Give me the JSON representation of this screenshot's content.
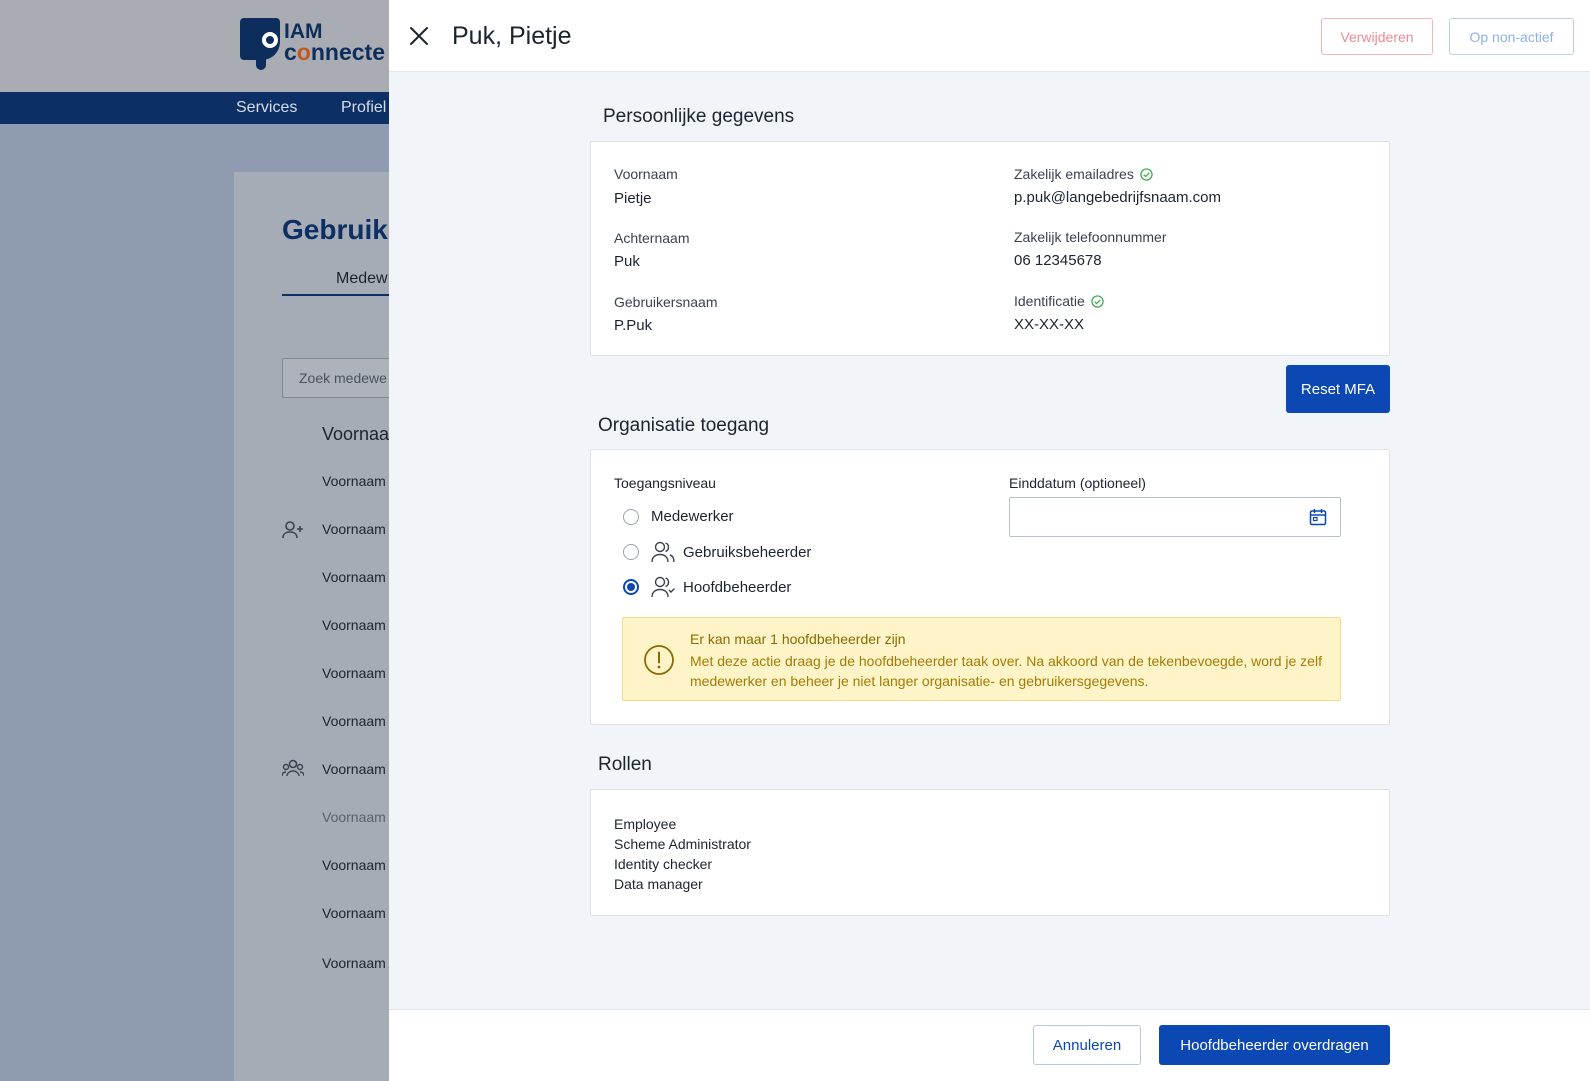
{
  "background": {
    "logo": {
      "line1": "IAM",
      "line2_a": "c",
      "line2_o": "o",
      "line2_b": "nnecte"
    },
    "nav": [
      "Services",
      "Profiel"
    ],
    "page_title": "Gebruik",
    "tab": "Medew",
    "search_placeholder": "Zoek medewe",
    "column_header": "Voornaa",
    "rows": [
      "Voornaam",
      "Voornaam",
      "Voornaam",
      "Voornaam",
      "Voornaam",
      "Voornaam",
      "Voornaam",
      "Voornaam",
      "Voornaam",
      "Voornaam",
      "Voornaam"
    ]
  },
  "panel": {
    "title": "Puk, Pietje",
    "delete_label": "Verwijderen",
    "inactive_label": "Op non-actief"
  },
  "personal": {
    "section_title": "Persoonlijke gegevens",
    "first_name_label": "Voornaam",
    "first_name": "Pietje",
    "last_name_label": "Achternaam",
    "last_name": "Puk",
    "username_label": "Gebruikersnaam",
    "username": "P.Puk",
    "email_label": "Zakelijk emailadres",
    "email": "p.puk@langebedrijfsnaam.com",
    "phone_label": "Zakelijk telefoonnummer",
    "phone": "06 12345678",
    "identification_label": "Identificatie",
    "identification": "XX-XX-XX",
    "reset_mfa_label": "Reset MFA"
  },
  "organisation": {
    "section_title": "Organisatie toegang",
    "access_level_label": "Toegangsniveau",
    "options": [
      "Medewerker",
      "Gebruiksbeheerder",
      "Hoofdbeheerder"
    ],
    "selected": "Hoofdbeheerder",
    "end_date_label": "Einddatum (optioneel)",
    "end_date_value": "",
    "warning_title": "Er kan maar 1 hoofdbeheerder zijn",
    "warning_body": "Met deze actie draag je de hoofdbeheerder taak over. Na akkoord van de tekenbevoegde, word je zelf medewerker en beheer je niet langer organisatie- en gebruikersgegevens."
  },
  "roles": {
    "section_title": "Rollen",
    "items": [
      "Employee",
      "Scheme Administrator",
      "Identity checker",
      "Data manager"
    ]
  },
  "footer": {
    "cancel_label": "Annuleren",
    "confirm_label": "Hoofdbeheerder overdragen"
  },
  "colors": {
    "primary": "#0c48b4",
    "nav": "#0c2f66",
    "warning_bg": "#fff4c8",
    "warning_text": "#a27c05",
    "verified": "#36a84a",
    "danger": "#ee8a90"
  },
  "icons": [
    "close-icon",
    "check-circle-icon",
    "user-icon",
    "users-icon",
    "admin-users-icon",
    "calendar-icon",
    "warning-icon",
    "logo-icon"
  ]
}
